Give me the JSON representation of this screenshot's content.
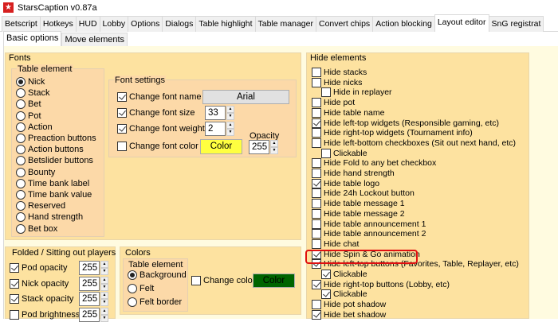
{
  "window": {
    "title": "StarsCaption v0.87a",
    "logo_icon": "star-icon"
  },
  "tabs": [
    "Betscript",
    "Hotkeys",
    "HUD",
    "Lobby",
    "Options",
    "Dialogs",
    "Table highlight",
    "Table manager",
    "Convert chips",
    "Action blocking",
    "Layout editor",
    "SnG registrat"
  ],
  "active_tab": "Layout editor",
  "subtabs": [
    "Basic options",
    "Move elements"
  ],
  "fonts": {
    "title": "Fonts",
    "table_element_title": "Table element",
    "elements": [
      {
        "label": "Nick",
        "selected": true
      },
      {
        "label": "Stack"
      },
      {
        "label": "Bet"
      },
      {
        "label": "Pot"
      },
      {
        "label": "Action"
      },
      {
        "label": "Preaction buttons"
      },
      {
        "label": "Action buttons"
      },
      {
        "label": "Betslider buttons"
      },
      {
        "label": "Bounty"
      },
      {
        "label": "Time bank label"
      },
      {
        "label": "Time bank value"
      },
      {
        "label": "Reserved"
      },
      {
        "label": "Hand strength"
      },
      {
        "label": "Bet box"
      }
    ],
    "settings_title": "Font settings",
    "change_font_name": {
      "label": "Change font name",
      "checked": true,
      "value": "Arial"
    },
    "change_font_size": {
      "label": "Change font size",
      "checked": true,
      "value": "33"
    },
    "change_font_weight": {
      "label": "Change font weight",
      "checked": true,
      "value": "2"
    },
    "change_font_color": {
      "label": "Change font color",
      "checked": false,
      "button": "Color",
      "color": "#ffff40"
    },
    "opacity_label": "Opacity",
    "opacity_value": "255"
  },
  "folded": {
    "title": "Folded / Sitting out players",
    "items": [
      {
        "label": "Pod opacity",
        "checked": true,
        "value": "255"
      },
      {
        "label": "Nick opacity",
        "checked": true,
        "value": "255"
      },
      {
        "label": "Stack opacity",
        "checked": true,
        "value": "255"
      },
      {
        "label": "Pod brightness",
        "checked": false,
        "value": "255"
      }
    ]
  },
  "colors": {
    "title": "Colors",
    "table_element_title": "Table element",
    "elements": [
      {
        "label": "Background",
        "selected": true
      },
      {
        "label": "Felt"
      },
      {
        "label": "Felt border"
      }
    ],
    "change_color_label": "Change color",
    "change_color_checked": false,
    "button": "Color",
    "color": "#006400"
  },
  "hide": {
    "title": "Hide elements",
    "items": [
      {
        "label": "Hide stacks",
        "checked": false,
        "indent": 0
      },
      {
        "label": "Hide nicks",
        "checked": false,
        "indent": 0
      },
      {
        "label": "Hide in replayer",
        "checked": false,
        "indent": 1
      },
      {
        "label": "Hide pot",
        "checked": false,
        "indent": 0
      },
      {
        "label": "Hide table name",
        "checked": false,
        "indent": 0
      },
      {
        "label": "Hide left-top widgets (Responsible gaming, etc)",
        "checked": true,
        "indent": 0
      },
      {
        "label": "Hide right-top widgets (Tournament info)",
        "checked": false,
        "indent": 0
      },
      {
        "label": "Hide left-bottom checkboxes (Sit out next hand, etc)",
        "checked": false,
        "indent": 0
      },
      {
        "label": "Clickable",
        "checked": false,
        "indent": 1
      },
      {
        "label": "Hide Fold to any bet checkbox",
        "checked": false,
        "indent": 0
      },
      {
        "label": "Hide hand strength",
        "checked": false,
        "indent": 0
      },
      {
        "label": "Hide table logo",
        "checked": true,
        "indent": 0
      },
      {
        "label": "Hide 24h Lockout button",
        "checked": false,
        "indent": 0
      },
      {
        "label": "Hide table message 1",
        "checked": false,
        "indent": 0
      },
      {
        "label": "Hide table message 2",
        "checked": false,
        "indent": 0
      },
      {
        "label": "Hide table announcement 1",
        "checked": false,
        "indent": 0
      },
      {
        "label": "Hide table announcement 2",
        "checked": false,
        "indent": 0
      },
      {
        "label": "Hide chat",
        "checked": false,
        "indent": 0
      },
      {
        "label": "Hide Spin & Go animation",
        "checked": true,
        "indent": 0
      },
      {
        "label": "Hide left-top buttons (Favorites, Table, Replayer, etc)",
        "checked": true,
        "indent": 0
      },
      {
        "label": "Clickable",
        "checked": true,
        "indent": 1
      },
      {
        "label": "Hide right-top buttons (Lobby, etc)",
        "checked": true,
        "indent": 0
      },
      {
        "label": "Clickable",
        "checked": true,
        "indent": 1
      },
      {
        "label": "Hide pot shadow",
        "checked": false,
        "indent": 0
      },
      {
        "label": "Hide bet shadow",
        "checked": true,
        "indent": 0
      }
    ]
  }
}
